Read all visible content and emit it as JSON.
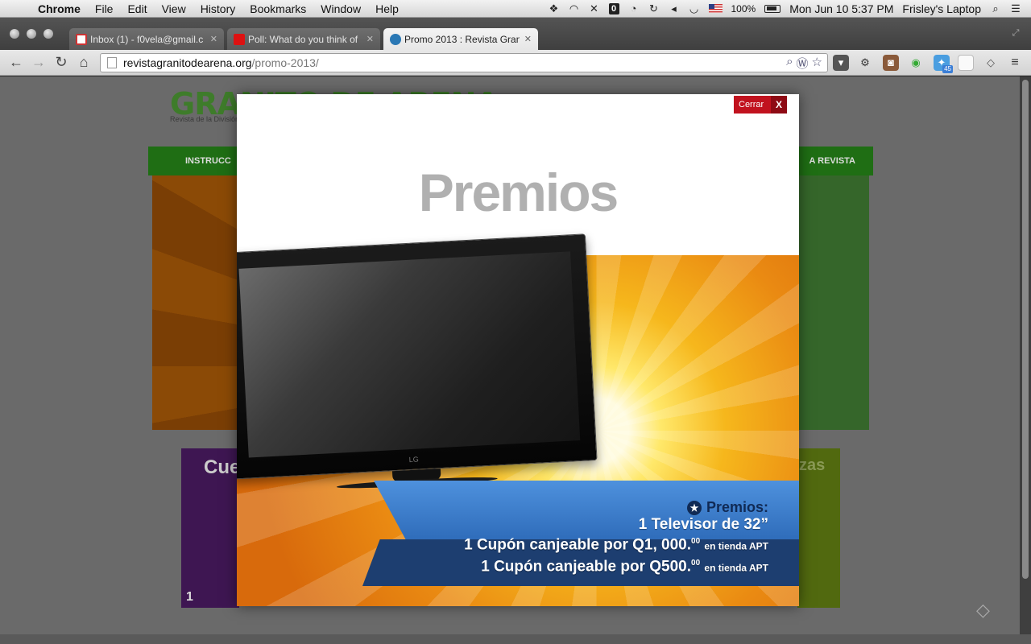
{
  "menubar": {
    "app_name": "Chrome",
    "menus": [
      "File",
      "Edit",
      "View",
      "History",
      "Bookmarks",
      "Window",
      "Help"
    ],
    "battery": "100%",
    "clock": "Mon Jun 10  5:37 PM",
    "user": "Frisley's Laptop"
  },
  "tabs": [
    {
      "label": "Inbox (1) - f0vela@gmail.c",
      "favicon": "gmail-icon"
    },
    {
      "label": "Poll: What do you think of",
      "favicon": "time-icon"
    },
    {
      "label": "Promo 2013 : Revista Gran",
      "favicon": "wordpress-icon"
    }
  ],
  "toolbar": {
    "url_host": "revistagranitodearena.org",
    "url_path": "/promo-2013/",
    "twitter_badge": "45"
  },
  "background_page": {
    "logo": "GRANITO DE ARENA",
    "tagline": "Revista de la División",
    "nav_left": "INSTRUCC",
    "nav_right": "A REVISTA",
    "card_left_heading": "Cue",
    "card_left_number": "1",
    "card_right_heading": "zas"
  },
  "modal": {
    "title": "Premios",
    "close_label": "Cerrar",
    "close_x": "X",
    "tv_brand": "LG",
    "prizes_heading": "Premios:",
    "prize_1": "1 Televisor de 32”",
    "prize_2_main": "1 Cupón canjeable por Q1, 000.",
    "prize_2_sup": "00",
    "prize_2_suffix": "en tienda APT",
    "prize_3_main": "1 Cupón canjeable por Q500.",
    "prize_3_sup": "00",
    "prize_3_suffix": "en tienda APT"
  },
  "colors": {
    "close_red": "#c1121e",
    "ribbon_blue": "#3a7bc8",
    "ribbon_navy": "#1d3e70",
    "title_gray": "#b0b0b0"
  }
}
